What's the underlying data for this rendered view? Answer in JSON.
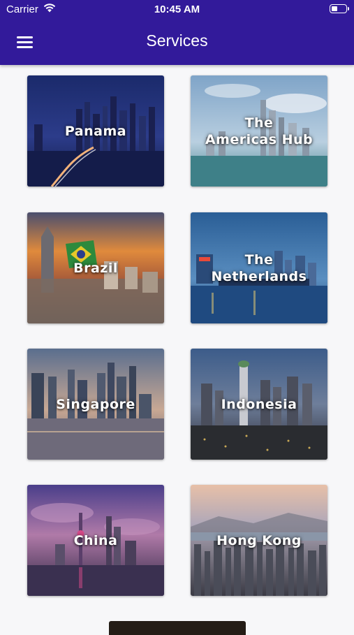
{
  "status_bar": {
    "carrier": "Carrier",
    "time": "10:45 AM",
    "battery_level": 0.45
  },
  "header": {
    "title": "Services",
    "menu_icon": "hamburger-menu-icon"
  },
  "services": [
    {
      "label": "Panama"
    },
    {
      "label": "The\nAmericas Hub"
    },
    {
      "label": "Brazil"
    },
    {
      "label": "The\nNetherlands"
    },
    {
      "label": "Singapore"
    },
    {
      "label": "Indonesia"
    },
    {
      "label": "China"
    },
    {
      "label": "Hong Kong"
    }
  ],
  "colors": {
    "header": "#321a9a",
    "background": "#f7f7f9"
  }
}
